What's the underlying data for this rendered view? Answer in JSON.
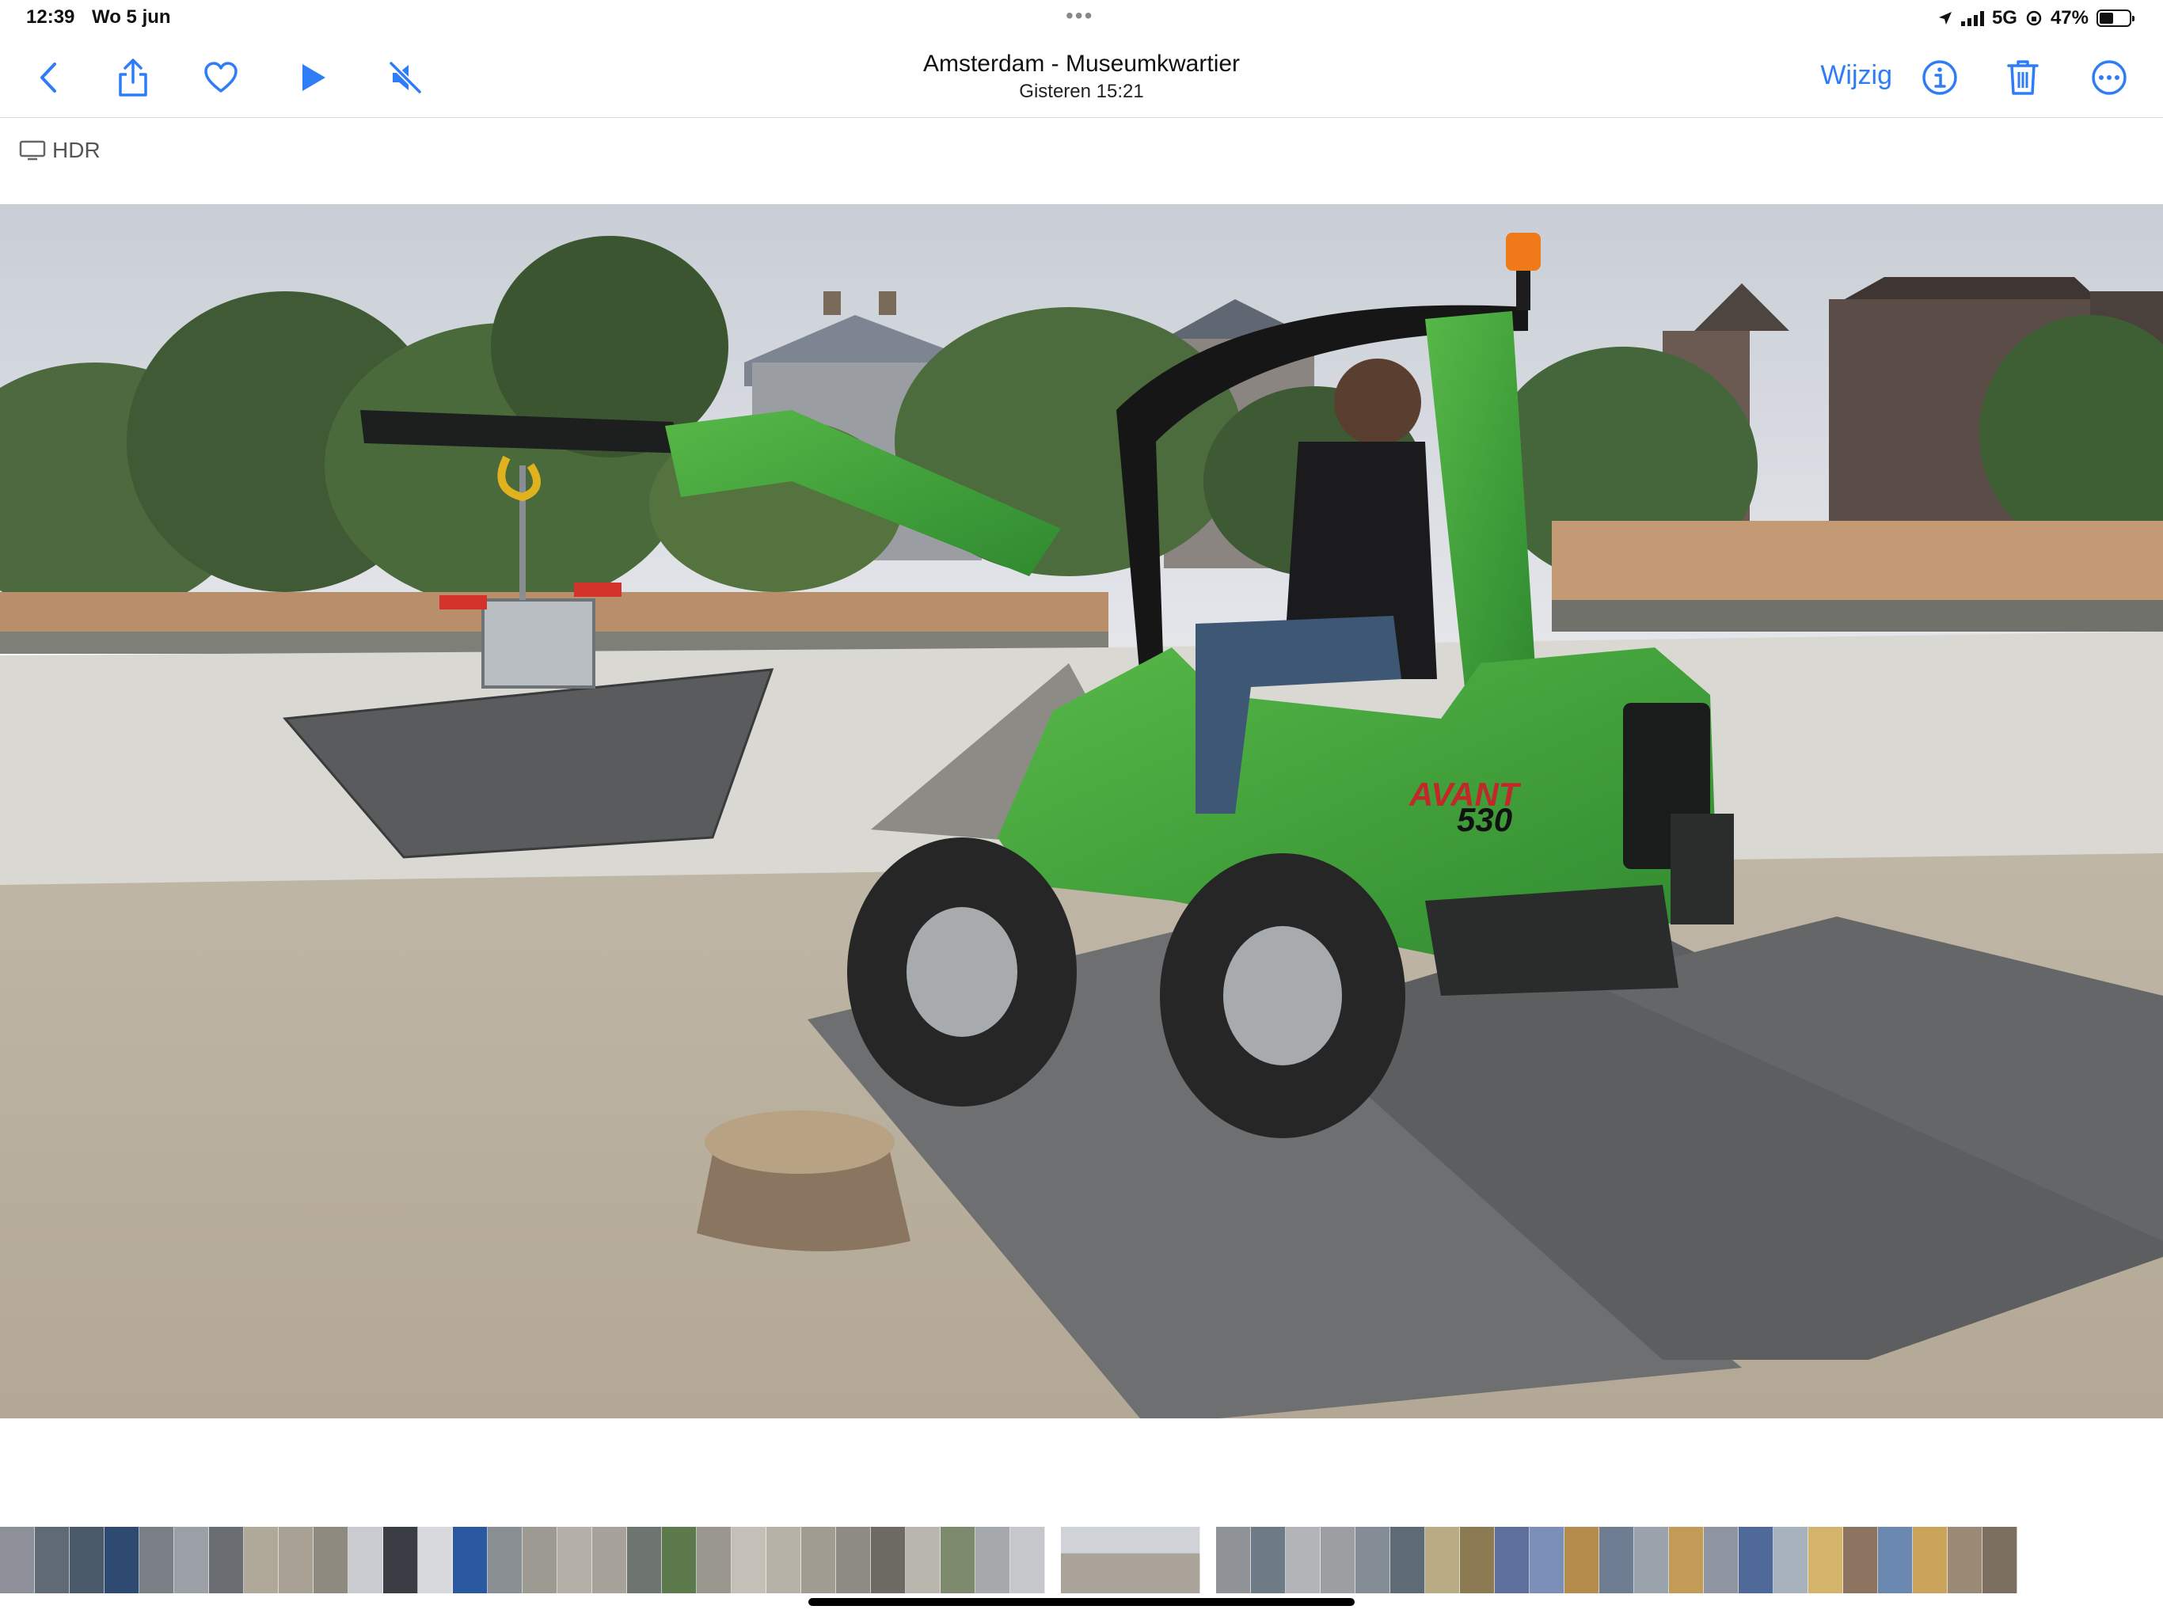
{
  "status_bar": {
    "time": "12:39",
    "date": "Wo 5 jun",
    "network": "5G",
    "battery": "47%",
    "battery_level": 0.47
  },
  "nav": {
    "title": "Amsterdam - Museumkwartier",
    "subtitle": "Gisteren  15:21",
    "edit_label": "Wijzig",
    "icons": [
      "chevron-left-icon",
      "share-icon",
      "heart-icon",
      "play-icon",
      "speaker-muted-icon",
      "info-icon",
      "trash-icon",
      "more-icon"
    ]
  },
  "badge": {
    "label": "HDR"
  },
  "photo": {
    "machine_brand": "AVANT",
    "machine_model": "530"
  },
  "accent_color": "#2f7df6"
}
